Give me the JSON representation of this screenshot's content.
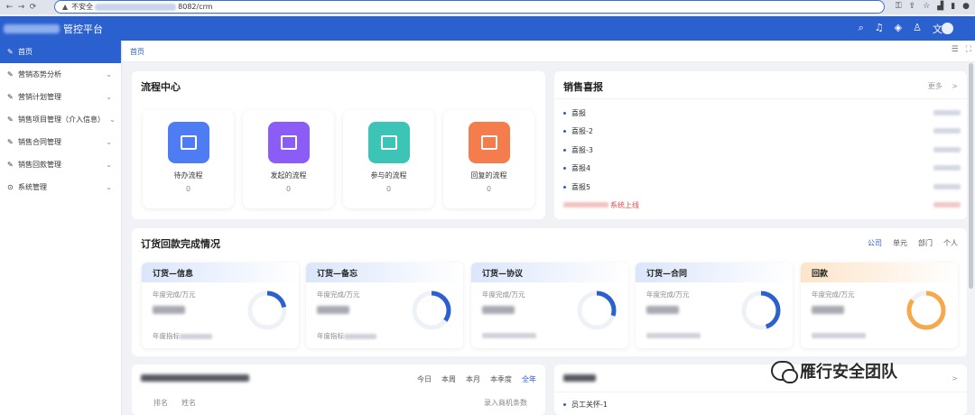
{
  "browser": {
    "security_label": "不安全",
    "url_suffix": "8082/crm"
  },
  "app": {
    "title": "管控平台"
  },
  "sidebar": {
    "items": [
      {
        "label": "首页"
      },
      {
        "label": "营销态势分析"
      },
      {
        "label": "营销计划管理"
      },
      {
        "label": "销售项目管理（介入信息）"
      },
      {
        "label": "销售合同管理"
      },
      {
        "label": "销售回款管理"
      },
      {
        "label": "系统管理"
      }
    ]
  },
  "tabbar": {
    "home": "首页"
  },
  "flow_center": {
    "title": "流程中心",
    "items": [
      {
        "label": "待办流程",
        "count": "0",
        "color": "#4d7cf3"
      },
      {
        "label": "发起的流程",
        "count": "0",
        "color": "#8b5cf6"
      },
      {
        "label": "参与的流程",
        "count": "0",
        "color": "#3cc4b6"
      },
      {
        "label": "回复的流程",
        "count": "0",
        "color": "#f47c4d"
      }
    ]
  },
  "sales_report": {
    "title": "销售喜报",
    "more": "更多",
    "more_arrow": ">",
    "items": [
      "喜报",
      "喜报-2",
      "喜报-3",
      "喜报4",
      "喜报5"
    ],
    "system_line": "系统上线"
  },
  "order_payment": {
    "title": "订货回款完成情况",
    "scopes": [
      "公司",
      "单元",
      "部门",
      "个人"
    ],
    "cards": [
      {
        "title": "订货—信息",
        "sub": "年度完成/万元",
        "foot": "年度指标",
        "progress": 0.22
      },
      {
        "title": "订货—备忘",
        "sub": "年度完成/万元",
        "foot": "年度指标",
        "progress": 0.35
      },
      {
        "title": "订货—协议",
        "sub": "年度完成/万元",
        "foot": "",
        "progress": 0.3
      },
      {
        "title": "订货—合同",
        "sub": "年度完成/万元",
        "foot": "",
        "progress": 0.45
      },
      {
        "title": "回款",
        "sub": "年度完成/万元",
        "foot": "",
        "progress": 0.85
      }
    ],
    "ring_colors": {
      "blue": "#2b60cf",
      "orange": "#f6a94a",
      "track": "#eef1f6"
    }
  },
  "ranking": {
    "periods": [
      "今日",
      "本周",
      "本月",
      "本季度",
      "全年"
    ],
    "col_rank": "排名",
    "col_name": "姓名",
    "col_count": "录入商机条数"
  },
  "care": {
    "more_arrow": ">",
    "item": "员工关怀-1"
  },
  "watermark": {
    "text": "雁行安全团队"
  }
}
